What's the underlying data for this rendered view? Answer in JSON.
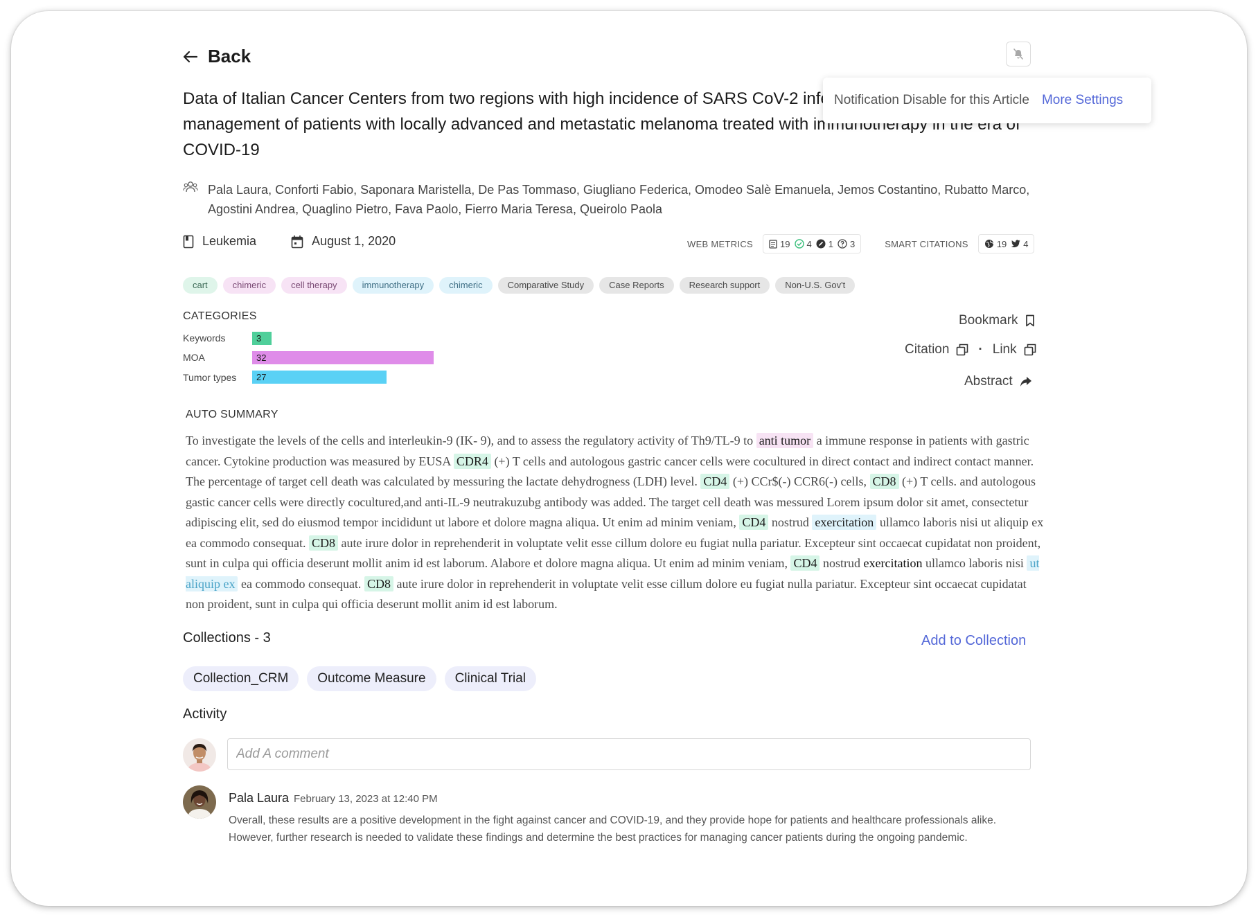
{
  "header": {
    "back_label": "Back"
  },
  "tooltip": {
    "text": "Notification Disable for this Article",
    "link": "More Settings"
  },
  "article": {
    "title": "Data of Italian Cancer Centers from two regions with high incidence of SARS CoV-2 infection: successful management of patients with locally advanced and metastatic melanoma treated with immunotherapy in the era of COVID-19",
    "authors": "Pala Laura, Conforti Fabio, Saponara Maristella, De Pas Tommaso, Giugliano Federica, Omodeo Salè Emanuela, Jemos Costantino, Rubatto Marco, Agostini Andrea, Quaglino Pietro, Fava Paolo, Fierro Maria Teresa, Queirolo Paola",
    "journal": "Leukemia",
    "date": "August 1, 2020"
  },
  "web_metrics": {
    "label": "WEB METRICS",
    "items": [
      {
        "icon": "document-icon",
        "value": "19"
      },
      {
        "icon": "check-circle-icon",
        "value": "4"
      },
      {
        "icon": "pencil-circle-icon",
        "value": "1"
      },
      {
        "icon": "question-circle-icon",
        "value": "3"
      }
    ]
  },
  "smart_citations": {
    "label": "SMART CITATIONS",
    "items": [
      {
        "icon": "globe-icon",
        "value": "19"
      },
      {
        "icon": "twitter-icon",
        "value": "4"
      }
    ]
  },
  "tags": [
    {
      "label": "cart",
      "bg": "#dff5ea",
      "color": "#3c6a56"
    },
    {
      "label": "chimeric",
      "bg": "#f7e3f5",
      "color": "#7a4a74"
    },
    {
      "label": "cell therapy",
      "bg": "#f7e3f5",
      "color": "#7a4a74"
    },
    {
      "label": "immunotherapy",
      "bg": "#dff3fb",
      "color": "#3f6f85"
    },
    {
      "label": "chimeric",
      "bg": "#dff3fb",
      "color": "#3f6f85"
    },
    {
      "label": "Comparative Study",
      "bg": "#e6e6e6",
      "color": "#4a4a4a"
    },
    {
      "label": "Case Reports",
      "bg": "#e6e6e6",
      "color": "#4a4a4a"
    },
    {
      "label": "Research support",
      "bg": "#e6e6e6",
      "color": "#4a4a4a"
    },
    {
      "label": "Non-U.S. Gov't",
      "bg": "#e6e6e6",
      "color": "#4a4a4a"
    }
  ],
  "categories": {
    "title": "CATEGORIES",
    "items": [
      {
        "label": "Keywords",
        "value": "3",
        "color": "#4fcf9a"
      },
      {
        "label": "MOA",
        "value": "32",
        "color": "#df8ce9"
      },
      {
        "label": "Tumor types",
        "value": "27",
        "color": "#5ad1f5"
      }
    ]
  },
  "actions": {
    "bookmark": "Bookmark",
    "citation": "Citation",
    "dot": "·",
    "link": "Link",
    "abstract": "Abstract"
  },
  "summary": {
    "title": "AUTO SUMMARY",
    "segments": [
      {
        "t": "To investigate the levels of the cells and interleukin-9 (IK- 9), and to assess the regulatory activity of Th9/TL-9 to "
      },
      {
        "t": "anti tumor",
        "hl": "pink"
      },
      {
        "t": " a immune response in patients with gastric cancer. Cytokine production was measured by EUSA "
      },
      {
        "t": "CDR4",
        "hl": "green"
      },
      {
        "t": " (+) T cells and autologous gastric cancer cells were cocultured in direct contact and indirect contact manner. The percentage of target cell death was calculated by messuring the lactate dehydrogness (LDH) level. "
      },
      {
        "t": "CD4",
        "hl": "green"
      },
      {
        "t": " (+) CCr$(-) CCR6(-) cells, "
      },
      {
        "t": "CD8",
        "hl": "green"
      },
      {
        "t": " (+) T cells. and autologous gastic cancer cells were directly cocultured,and anti-IL-9 neutrakuzubg antibody was added. The target cell death was messured Lorem ipsum dolor sit amet, consectetur adipiscing elit, sed do eiusmod tempor incididunt ut labore et dolore magna aliqua. Ut enim ad minim veniam, "
      },
      {
        "t": "CD4",
        "hl": "green"
      },
      {
        "t": " nostrud "
      },
      {
        "t": "exercitation",
        "hl": "blue"
      },
      {
        "t": " ullamco laboris nisi ut aliquip ex ea commodo consequat. "
      },
      {
        "t": "CD8",
        "hl": "green"
      },
      {
        "t": " aute irure dolor in reprehenderit in voluptate velit esse cillum dolore eu fugiat nulla pariatur. Excepteur sint occaecat cupidatat non proident, sunt in culpa qui officia deserunt mollit anim id est laborum. Alabore et dolore magna aliqua. Ut enim ad minim veniam, "
      },
      {
        "t": "CD4",
        "hl": "green"
      },
      {
        "t": " nostrud "
      },
      {
        "t": "exercitation",
        "hl": "bold"
      },
      {
        "t": " ullamco laboris nisi "
      },
      {
        "t": "ut aliquip ex",
        "hl": "bluetxt"
      },
      {
        "t": " ea commodo consequat. "
      },
      {
        "t": "CD8",
        "hl": "green"
      },
      {
        "t": " aute irure dolor in reprehenderit in voluptate velit esse cillum dolore eu fugiat nulla pariatur. Excepteur sint occaecat cupidatat non proident, sunt in culpa qui officia deserunt mollit anim id est laborum."
      }
    ]
  },
  "collections": {
    "title": "Collections - 3",
    "add_label": "Add to Collection",
    "items": [
      "Collection_CRM",
      "Outcome Measure",
      "Clinical Trial"
    ]
  },
  "activity": {
    "title": "Activity",
    "placeholder": "Add A comment",
    "comment": {
      "author": "Pala Laura",
      "time": "February 13, 2023 at 12:40 PM",
      "body": "Overall, these results are a positive development in the fight against cancer and COVID-19, and they provide hope for patients and healthcare professionals alike. However, further research is needed to validate these findings and determine the best practices for managing cancer patients during the ongoing pandemic."
    }
  }
}
